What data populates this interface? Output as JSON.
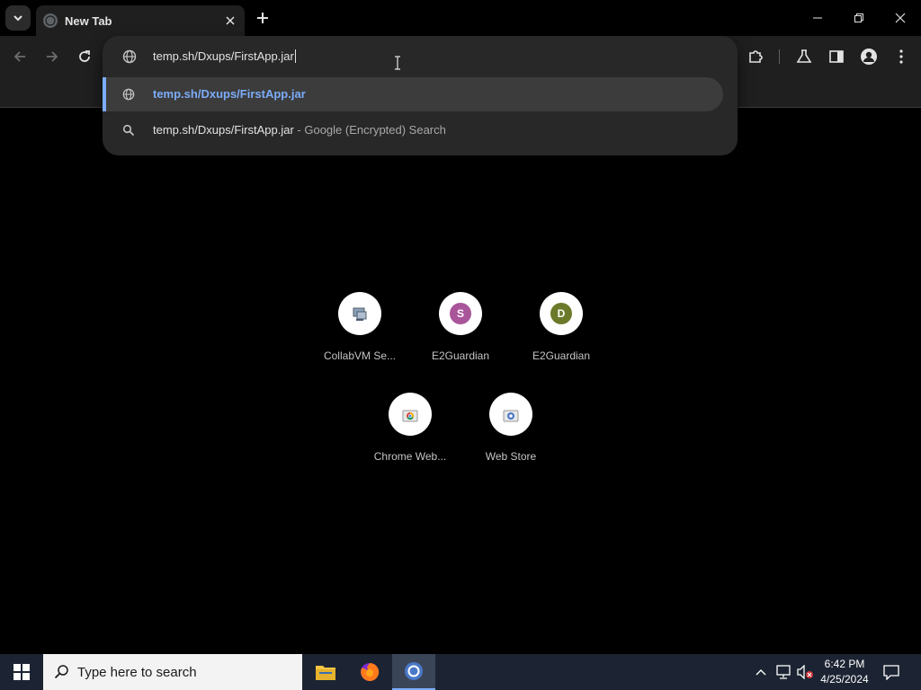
{
  "browser": {
    "tab": {
      "title": "New Tab"
    },
    "omnibox": {
      "input_value": "temp.sh/Dxups/FirstApp.jar",
      "suggestions": [
        {
          "text": "temp.sh/Dxups/FirstApp.jar",
          "icon": "globe-icon"
        },
        {
          "text": "temp.sh/Dxups/FirstApp.jar",
          "subtext": "- Google (Encrypted) Search",
          "icon": "search-icon"
        }
      ]
    },
    "shortcuts": [
      {
        "label": "CollabVM Se...",
        "icon": "collabvm-icon"
      },
      {
        "label": "E2Guardian",
        "letter": "S",
        "color": "#a9559a"
      },
      {
        "label": "E2Guardian",
        "letter": "D",
        "color": "#6b7a2a"
      },
      {
        "label": "Chrome Web...",
        "icon": "chrome-webstore-icon"
      },
      {
        "label": "Web Store",
        "icon": "webstore-icon"
      }
    ]
  },
  "taskbar": {
    "search_placeholder": "Type here to search",
    "time": "6:42 PM",
    "date": "4/25/2024"
  },
  "colors": {
    "accent": "#7cacf8",
    "taskbar": "#1c2433",
    "chrome_active": "#1f1f1f"
  }
}
